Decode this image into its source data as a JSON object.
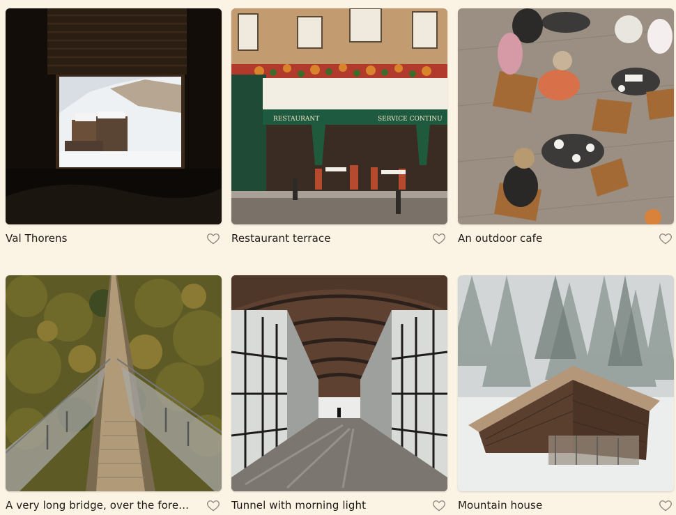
{
  "gallery": {
    "items": [
      {
        "caption": "Val Thorens",
        "favorite_icon": "heart-outline-icon",
        "image": "snowy-village-through-window"
      },
      {
        "caption": "Restaurant terrace",
        "favorite_icon": "heart-outline-icon",
        "image": "paris-restaurant-facade"
      },
      {
        "caption": "An outdoor cafe",
        "favorite_icon": "heart-outline-icon",
        "image": "cafe-tables-overhead"
      },
      {
        "caption": "A very long bridge, over the fore…",
        "favorite_icon": "heart-outline-icon",
        "image": "suspension-bridge-forest"
      },
      {
        "caption": "Tunnel with morning light",
        "favorite_icon": "heart-outline-icon",
        "image": "glass-walled-tunnel"
      },
      {
        "caption": "Mountain house",
        "favorite_icon": "heart-outline-icon",
        "image": "wooden-hut-snow"
      }
    ]
  },
  "colors": {
    "background": "#fbf3e4",
    "text": "#1d1a16",
    "heart_stroke": "#8a857c"
  }
}
